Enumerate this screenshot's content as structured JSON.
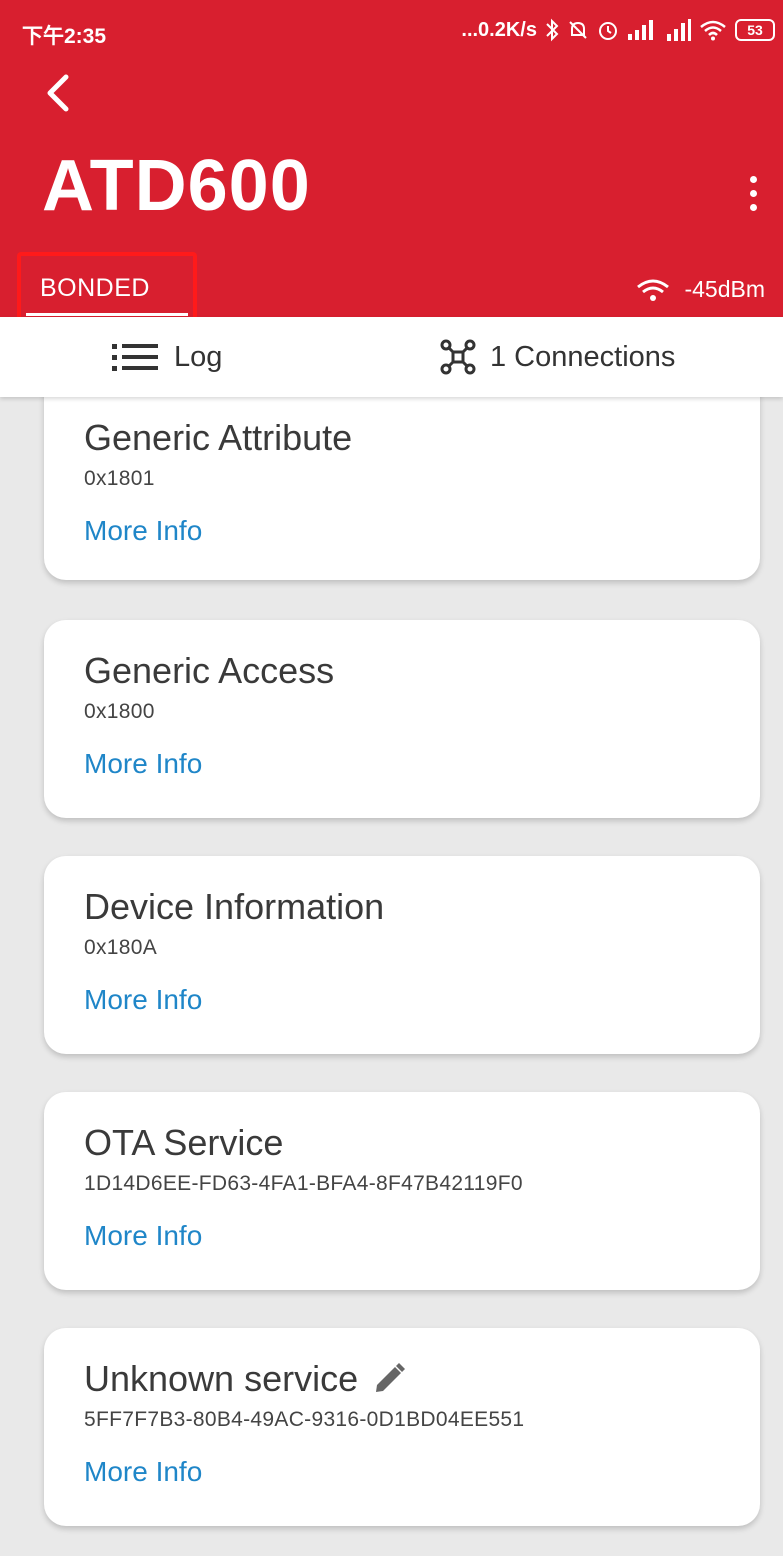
{
  "status_bar": {
    "time": "下午2:35",
    "net_speed": "...0.2K/s",
    "battery": "53"
  },
  "app_bar": {
    "device_name": "ATD600",
    "bond_state": "BONDED",
    "rssi": "-45dBm"
  },
  "tabs": {
    "log": "Log",
    "connections": "1 Connections"
  },
  "services": [
    {
      "name": "Generic Attribute",
      "uuid": "0x1801",
      "link": "More Info"
    },
    {
      "name": "Generic Access",
      "uuid": "0x1800",
      "link": "More Info"
    },
    {
      "name": "Device Information",
      "uuid": "0x180A",
      "link": "More Info"
    },
    {
      "name": "OTA Service",
      "uuid": "1D14D6EE-FD63-4FA1-BFA4-8F47B42119F0",
      "link": "More Info"
    },
    {
      "name": "Unknown service",
      "uuid": "5FF7F7B3-80B4-49AC-9316-0D1BD04EE551",
      "link": "More Info"
    }
  ],
  "icons": {
    "back": "chevron-left-icon",
    "overflow": "more-vert-icon",
    "rssi": "wifi-icon",
    "log": "list-icon",
    "connections": "connections-icon",
    "rename": "pencil-icon"
  },
  "colors": {
    "header": "#d81f2f",
    "highlight": "#ff1a1a",
    "link": "#1f86c8"
  }
}
